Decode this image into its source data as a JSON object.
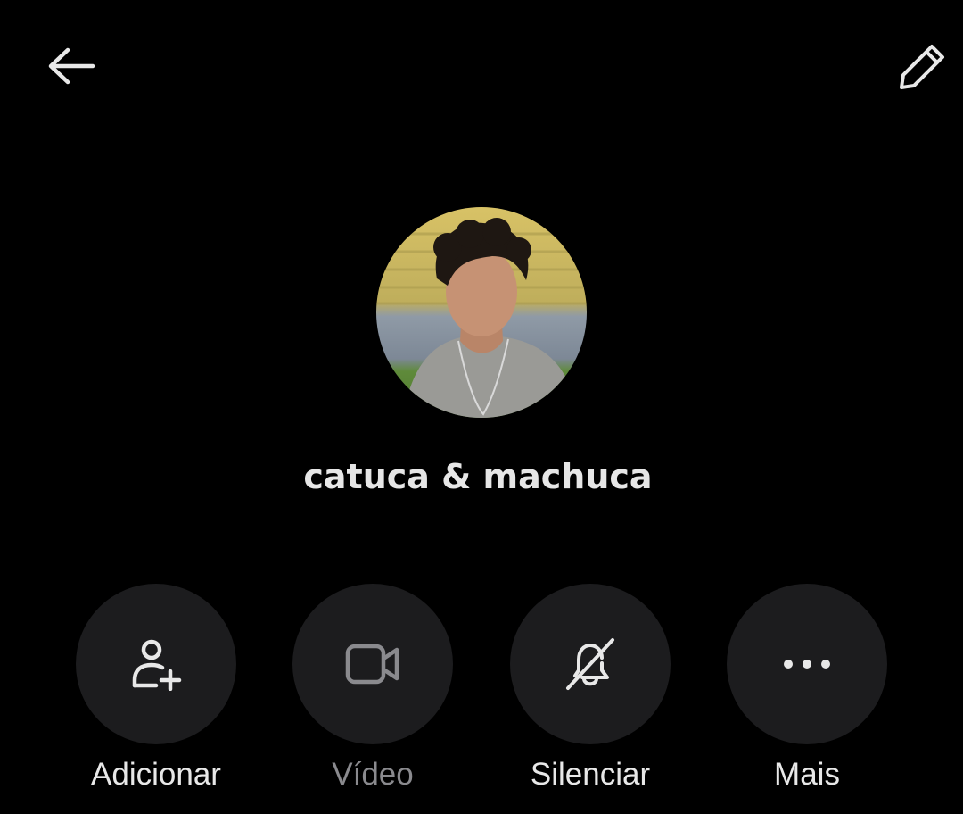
{
  "header": {
    "back_icon": "arrow-left-icon",
    "edit_icon": "pencil-icon"
  },
  "group": {
    "name": "catuca & machuca",
    "avatar": "group-avatar-photo"
  },
  "actions": [
    {
      "label": "Adicionar",
      "icon": "add-person-icon",
      "enabled": true
    },
    {
      "label": "Vídeo",
      "icon": "video-camera-icon",
      "enabled": false
    },
    {
      "label": "Silenciar",
      "icon": "bell-off-icon",
      "enabled": true
    },
    {
      "label": "Mais",
      "icon": "more-horizontal-icon",
      "enabled": true
    }
  ],
  "colors": {
    "background": "#000000",
    "button_bg": "#1c1c1e",
    "text": "#e8e8e8",
    "disabled_text": "#8a8a8e"
  }
}
